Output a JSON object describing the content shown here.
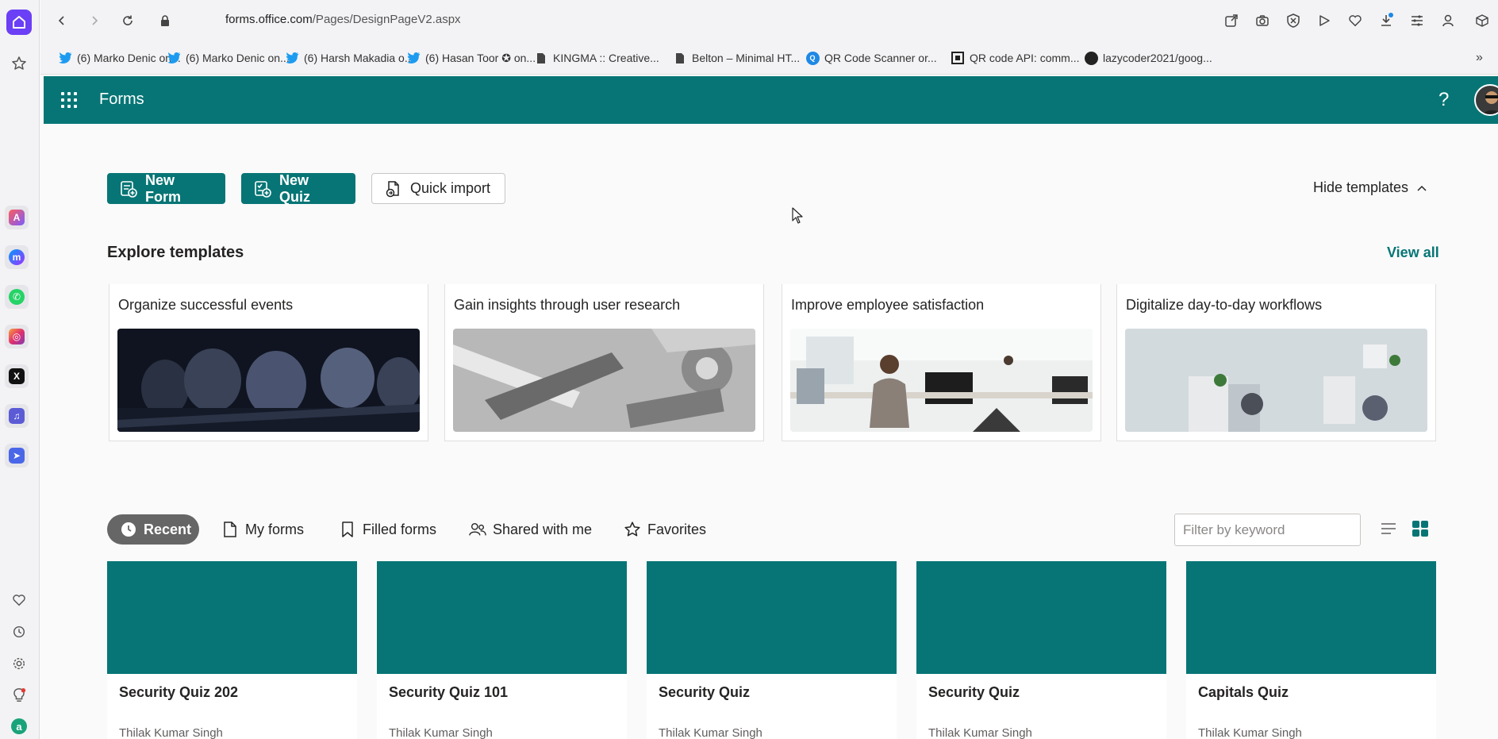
{
  "browser": {
    "url_host": "forms.office.com",
    "url_path": "/Pages/DesignPageV2.aspx",
    "bookmarks": [
      {
        "label": "(6) Marko Denic on...",
        "icon": "twitter-icon"
      },
      {
        "label": "(6) Marko Denic on...",
        "icon": "twitter-icon"
      },
      {
        "label": "(6) Harsh Makadia o...",
        "icon": "twitter-icon"
      },
      {
        "label": "(6) Hasan Toor ✪ on...",
        "icon": "twitter-icon"
      },
      {
        "label": "KINGMA :: Creative...",
        "icon": "page-icon"
      },
      {
        "label": "Belton – Minimal HT...",
        "icon": "page-icon"
      },
      {
        "label": "QR Code Scanner or...",
        "icon": "qr-scanner-icon"
      },
      {
        "label": "QR code API: comm...",
        "icon": "qr-code-icon"
      },
      {
        "label": "lazycoder2021/goog...",
        "icon": "github-icon"
      }
    ]
  },
  "app": {
    "name": "Forms",
    "accent": "#077575"
  },
  "actions": {
    "new_form": "New Form",
    "new_quiz": "New Quiz",
    "quick_import": "Quick import",
    "hide_templates": "Hide templates"
  },
  "templates": {
    "title": "Explore templates",
    "view_all": "View all",
    "items": [
      {
        "title": "Organize successful events"
      },
      {
        "title": "Gain insights through user research"
      },
      {
        "title": "Improve employee satisfaction"
      },
      {
        "title": "Digitalize day-to-day workflows"
      }
    ]
  },
  "tabs": {
    "recent": "Recent",
    "my_forms": "My forms",
    "filled_forms": "Filled forms",
    "shared_with_me": "Shared with me",
    "favorites": "Favorites"
  },
  "filter": {
    "placeholder": "Filter by keyword"
  },
  "forms": [
    {
      "title": "Security Quiz 202",
      "owner": "Thilak Kumar Singh"
    },
    {
      "title": "Security Quiz 101",
      "owner": "Thilak Kumar Singh"
    },
    {
      "title": "Security Quiz",
      "owner": "Thilak Kumar Singh"
    },
    {
      "title": "Security Quiz",
      "owner": "Thilak Kumar Singh"
    },
    {
      "title": "Capitals Quiz",
      "owner": "Thilak Kumar Singh"
    }
  ]
}
